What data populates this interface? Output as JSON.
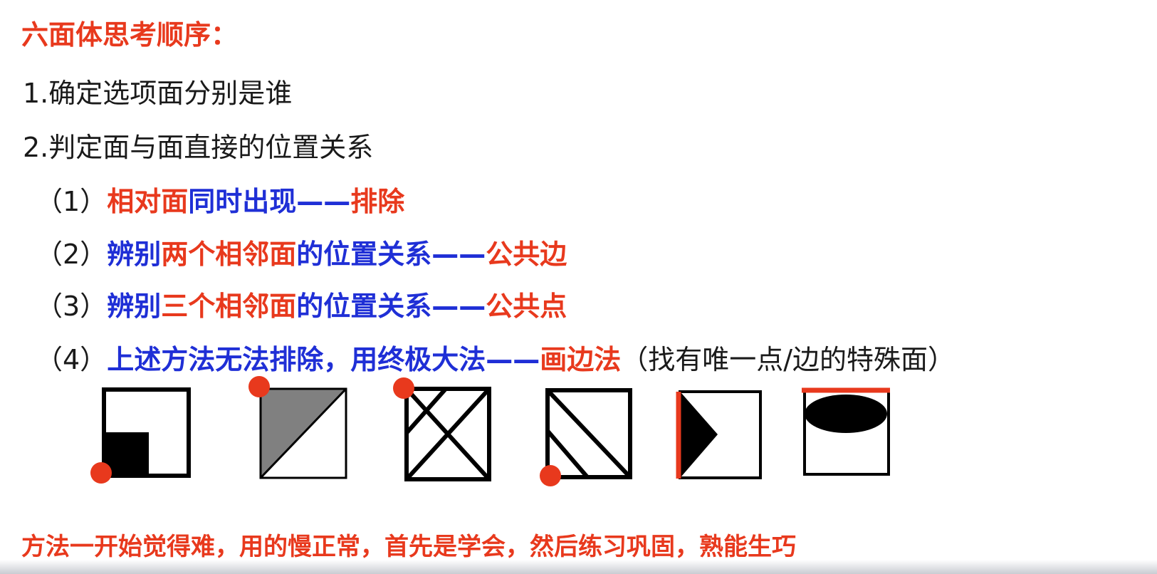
{
  "title": "六面体思考顺序：",
  "steps": [
    "1.确定选项面分别是谁",
    "2.判定面与面直接的位置关系"
  ],
  "rules": [
    {
      "num": "（1）",
      "parts": [
        "相对面",
        "同时出现",
        "——",
        "排除"
      ]
    },
    {
      "num": "（2）",
      "parts": [
        "辨别",
        "两个相邻面",
        "的位置关系",
        "——",
        "公共边"
      ]
    },
    {
      "num": "（3）",
      "parts": [
        "辨别",
        "三个相邻面",
        "的位置关系",
        "——",
        "公共点"
      ]
    },
    {
      "num": "（4）",
      "parts": [
        "上述方法无法排除，用终极大法",
        "——",
        "画边法",
        "（找有唯一点/边的特殊面）"
      ]
    }
  ],
  "footer": "方法一开始觉得难，用的慢正常，首先是学会，然后练习巩固，熟能生巧",
  "colors": {
    "red": "#e8391d",
    "blue": "#1f2fd6",
    "gray": "#808080",
    "black": "#000000"
  }
}
